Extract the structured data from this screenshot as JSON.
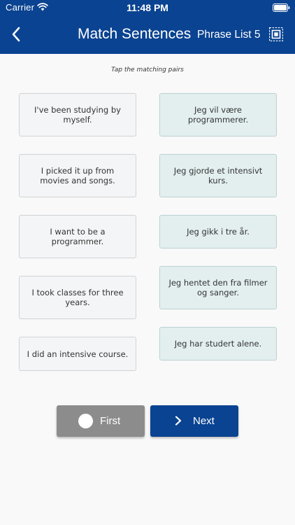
{
  "status_bar": {
    "carrier": "Carrier",
    "time": "11:48 PM"
  },
  "nav": {
    "title": "Match Sentences",
    "subtitle": "Phrase List 5",
    "back_icon": "chevron-left-icon",
    "right_icon": "grid-select-icon"
  },
  "instruction": "Tap the matching pairs",
  "left_cards": [
    "I've been studying by myself.",
    "I picked it up from movies and songs.",
    "I want to be a programmer.",
    "I took classes for three years.",
    "I did an intensive course."
  ],
  "right_cards": [
    "Jeg vil være programmerer.",
    "Jeg gjorde et intensivt kurs.",
    "Jeg gikk i tre år.",
    "Jeg hentet den fra filmer og sanger.",
    "Jeg har studert alene."
  ],
  "buttons": {
    "first_label": "First",
    "next_label": "Next"
  },
  "colors": {
    "header": "#0a4391",
    "left_card": "#f4f5f6",
    "right_card": "#e3efef",
    "first_button": "#8c8c8c",
    "next_button": "#0a4391"
  }
}
